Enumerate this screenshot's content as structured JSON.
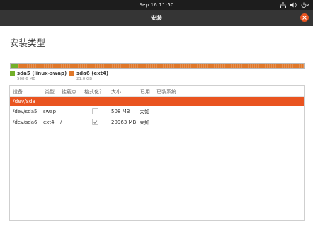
{
  "topbar": {
    "clock": "Sep 16  11:50"
  },
  "window": {
    "title": "安装"
  },
  "page": {
    "heading": "安装类型"
  },
  "partition_bar": {
    "segments": [
      {
        "name": "sda5 (linux-swap)",
        "size": "508.6 MB",
        "color": "#73b02a"
      },
      {
        "name": "sda6 (ext4)",
        "size": "21.0 GB",
        "color": "#e0782a"
      }
    ]
  },
  "table": {
    "columns": [
      "设备",
      "类型",
      "挂载点",
      "格式化？",
      "大小",
      "已用",
      "已装系统"
    ],
    "group": "/dev/sda",
    "rows": [
      {
        "device": "/dev/sda5",
        "type": "swap",
        "mount": "",
        "format": false,
        "size": "508 MB",
        "used": "未知",
        "system": ""
      },
      {
        "device": "/dev/sda6",
        "type": "ext4",
        "mount": "/",
        "format": true,
        "size": "20963 MB",
        "used": "未知",
        "system": ""
      }
    ]
  },
  "colors": {
    "accent": "#e95420",
    "titlebar": "#353535",
    "topbar": "#1d1d1d"
  },
  "icons": [
    "network-icon",
    "volume-icon",
    "power-icon",
    "close-icon",
    "checkmark-icon"
  ]
}
